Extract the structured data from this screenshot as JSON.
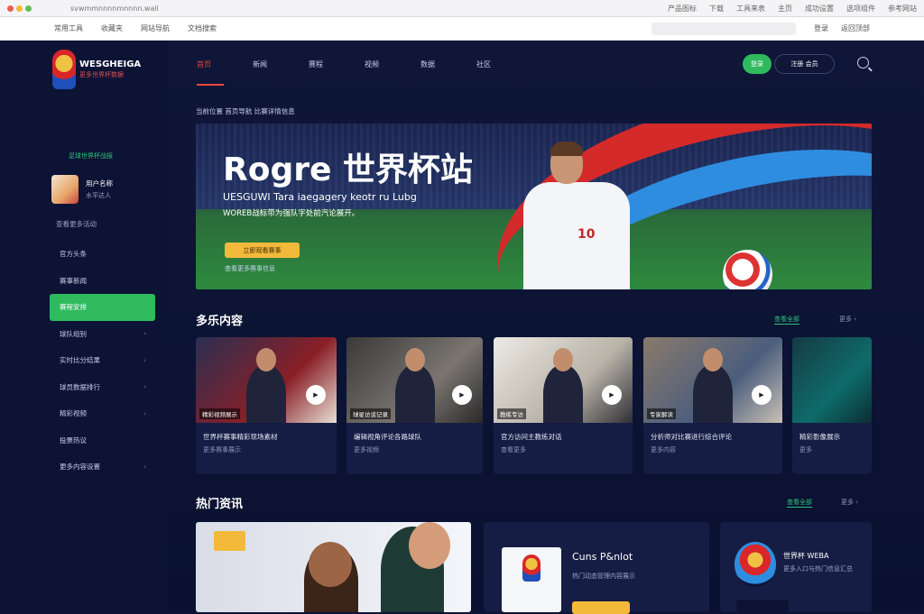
{
  "browser": {
    "url": "s​v​w​m​m​n​n​n​n​m​n​n​n​n.​w​a​l​i",
    "right_items": [
      "产品图标",
      "下载",
      "工具来表",
      "主页",
      "成功设置",
      "选项组件",
      "参考网站"
    ],
    "bookmarks": [
      "常用工具",
      "收藏夹",
      "网站导航",
      "文档搜索"
    ],
    "toolbar_right": [
      "登录",
      "返回顶部"
    ]
  },
  "sidebar": {
    "logo_title": "WESGHEIGA",
    "logo_subtitle": "更多世界杯数据",
    "tag": "足球世界杯战报",
    "profile_name": "用户名称",
    "profile_sub": "水平达人",
    "side_link": "查看更多活动",
    "menu": [
      {
        "label": "官方头条",
        "chevron": false,
        "active": false
      },
      {
        "label": "赛事新闻",
        "chevron": false,
        "active": false
      },
      {
        "label": "赛程安排",
        "chevron": false,
        "active": true
      },
      {
        "label": "球队组别",
        "chevron": true,
        "active": false
      },
      {
        "label": "实时比分结果",
        "chevron": true,
        "active": false
      },
      {
        "label": "球员数据排行",
        "chevron": true,
        "active": false
      },
      {
        "label": "精彩视频",
        "chevron": true,
        "active": false
      },
      {
        "label": "投票热议",
        "chevron": false,
        "active": false
      },
      {
        "label": "更多内容设置",
        "chevron": true,
        "active": false
      }
    ]
  },
  "topnav": {
    "tabs": [
      "首页",
      "新闻",
      "赛程",
      "视频",
      "数据",
      "社区"
    ],
    "primary_button": "登录",
    "secondary_button": "注册 会员"
  },
  "breadcrumb": "当前位置 首页导航  比赛详情信息",
  "hero": {
    "title": "Rogre 世界杯站",
    "subtitle": "UESGUWI Tara iaegagery keotr ru Lubg",
    "subtitle2": "WOREB战标带为强队字处前汽论展开。",
    "cta": "立即观看赛事",
    "cta_secondary": "查看更多赛事信息",
    "jersey_number": "10"
  },
  "section1": {
    "title": "多乐内容",
    "tag": "查看全部",
    "link": "更多 ›",
    "cards": [
      {
        "badge": "精彩视频展示",
        "title": "世界杯赛事精彩现场素材",
        "meta": "更多赛事展示",
        "play": "▶"
      },
      {
        "badge": "球星访谈记录",
        "title": "编辑视角评论各路球队",
        "meta": "更多视频",
        "play": "▶"
      },
      {
        "badge": "教练专访",
        "title": "官方访问主教练对话",
        "meta": "查看更多",
        "play": "▶"
      },
      {
        "badge": "专家解读",
        "title": "分析师对比赛进行综合评论",
        "meta": "更多内容",
        "play": "▶"
      },
      {
        "badge": "",
        "title": "精彩影像展示",
        "meta": "更多",
        "play": ""
      }
    ]
  },
  "section2": {
    "title": "热门资讯",
    "tag": "查看全部",
    "link": "更多 ›",
    "mid_title": "Cuns P&nlot",
    "mid_desc": "热门动态管理内容展示",
    "right_title": "世界杯 WEBA",
    "right_desc": "更多入口与热门信息汇总"
  },
  "colors": {
    "accent_green": "#2fba5e",
    "accent_red": "#e8483a",
    "cta_yellow": "#f3b93b",
    "bg": "#0d1433"
  }
}
